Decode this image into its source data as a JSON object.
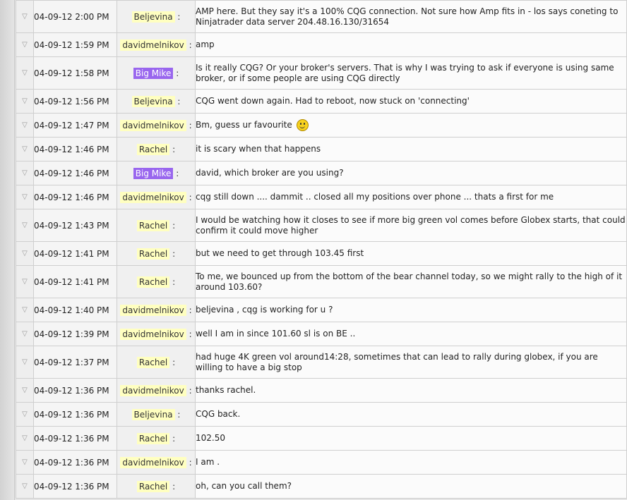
{
  "arrow_glyph": "▽",
  "colors": {
    "name_highlight": "#ffffc0",
    "staff_badge": "#9966ee"
  },
  "rows": [
    {
      "time": "04-09-12 2:00 PM",
      "user": "Beljevina",
      "staff": false,
      "sep": ":",
      "tall": true,
      "message": "AMP here. But they say it's a 100% CQG connection. Not sure how Amp fits in - los says coneting to Ninjatrader data server 204.48.16.130/31654"
    },
    {
      "time": "04-09-12 1:59 PM",
      "user": "davidmelnikov",
      "staff": false,
      "sep": ":",
      "tall": false,
      "message": "amp"
    },
    {
      "time": "04-09-12 1:58 PM",
      "user": "Big Mike",
      "staff": true,
      "sep": ":",
      "tall": true,
      "message": "Is it really CQG? Or your broker's servers. That is why I was trying to ask if everyone is using same broker, or if some people are using CQG directly"
    },
    {
      "time": "04-09-12 1:56 PM",
      "user": "Beljevina",
      "staff": false,
      "sep": ":",
      "tall": false,
      "message": "CQG went down again. Had to reboot, now stuck on 'connecting'"
    },
    {
      "time": "04-09-12 1:47 PM",
      "user": "davidmelnikov",
      "staff": false,
      "sep": ":",
      "tall": false,
      "message": "Bm, guess ur favourite",
      "smiley": true
    },
    {
      "time": "04-09-12 1:46 PM",
      "user": "Rachel",
      "staff": false,
      "sep": ":",
      "tall": false,
      "message": "it is scary when that happens"
    },
    {
      "time": "04-09-12 1:46 PM",
      "user": "Big Mike",
      "staff": true,
      "sep": ":",
      "tall": false,
      "message": "david, which broker are you using?"
    },
    {
      "time": "04-09-12 1:46 PM",
      "user": "davidmelnikov",
      "staff": false,
      "sep": ":",
      "tall": false,
      "message": "cqg still down .... dammit .. closed all my positions over phone ... thats a first for me"
    },
    {
      "time": "04-09-12 1:43 PM",
      "user": "Rachel",
      "staff": false,
      "sep": ":",
      "tall": true,
      "message": "I would be watching how it closes to see if more big green vol comes before Globex starts, that could confirm it could move higher"
    },
    {
      "time": "04-09-12 1:41 PM",
      "user": "Rachel",
      "staff": false,
      "sep": ":",
      "tall": false,
      "message": "but we need to get through 103.45 first"
    },
    {
      "time": "04-09-12 1:41 PM",
      "user": "Rachel",
      "staff": false,
      "sep": ":",
      "tall": true,
      "message": "To me, we bounced up from the bottom of the bear channel today, so we might rally to the high of it around 103.60?"
    },
    {
      "time": "04-09-12 1:40 PM",
      "user": "davidmelnikov",
      "staff": false,
      "sep": ":",
      "tall": false,
      "message": "beljevina , cqg is working for u ?"
    },
    {
      "time": "04-09-12 1:39 PM",
      "user": "davidmelnikov",
      "staff": false,
      "sep": ":",
      "tall": false,
      "message": "well I am in since 101.60 sl is on BE .."
    },
    {
      "time": "04-09-12 1:37 PM",
      "user": "Rachel",
      "staff": false,
      "sep": ":",
      "tall": true,
      "message": "had huge 4K green vol around14:28, sometimes that can lead to rally during globex, if you are willing to have a big stop"
    },
    {
      "time": "04-09-12 1:36 PM",
      "user": "davidmelnikov",
      "staff": false,
      "sep": ":",
      "tall": false,
      "message": "thanks rachel."
    },
    {
      "time": "04-09-12 1:36 PM",
      "user": "Beljevina",
      "staff": false,
      "sep": ":",
      "tall": false,
      "message": "CQG back."
    },
    {
      "time": "04-09-12 1:36 PM",
      "user": "Rachel",
      "staff": false,
      "sep": ":",
      "tall": false,
      "message": "102.50"
    },
    {
      "time": "04-09-12 1:36 PM",
      "user": "davidmelnikov",
      "staff": false,
      "sep": ":",
      "tall": false,
      "message": "I am ."
    },
    {
      "time": "04-09-12 1:36 PM",
      "user": "Rachel",
      "staff": false,
      "sep": ":",
      "tall": false,
      "message": "oh, can you call them?"
    }
  ]
}
